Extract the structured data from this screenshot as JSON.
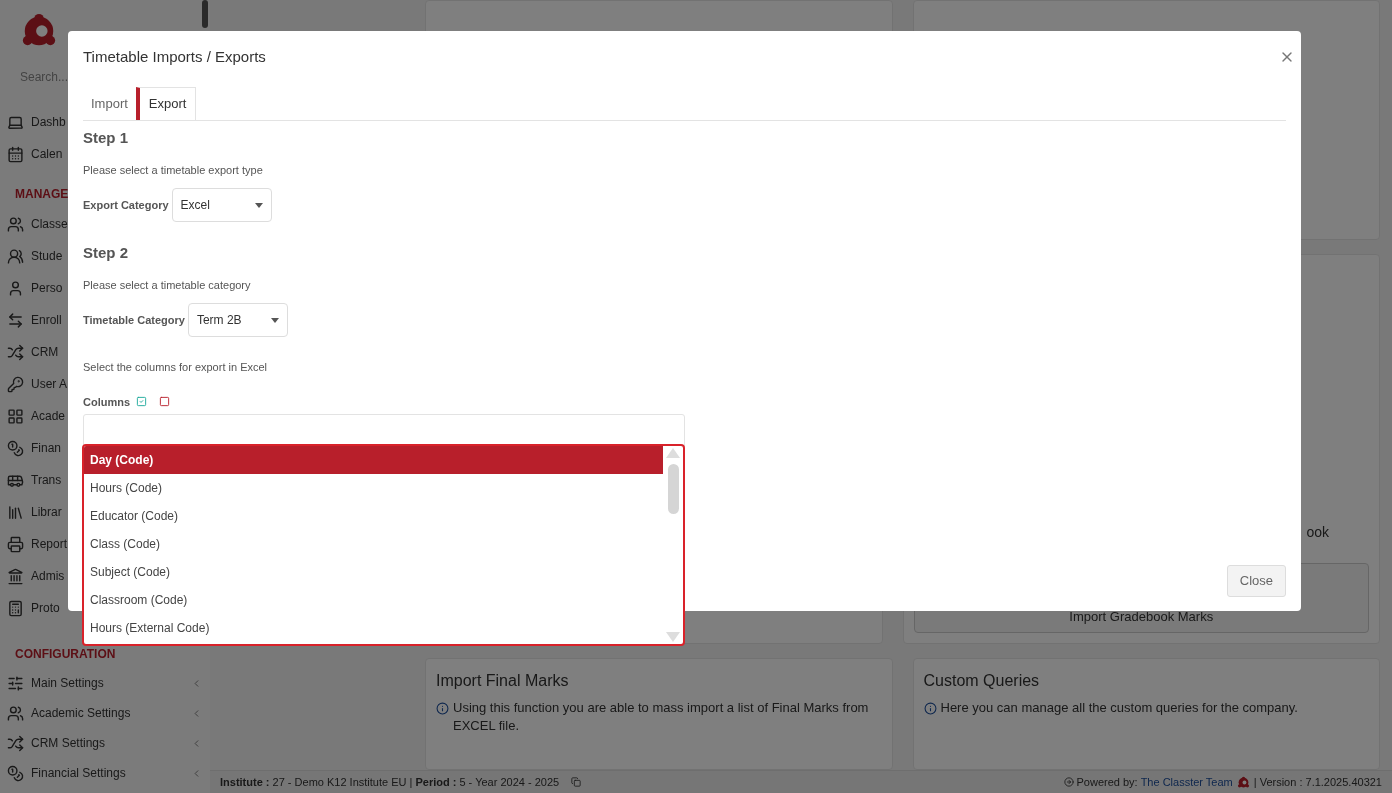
{
  "sidebar": {
    "search_placeholder": "Search...",
    "top_items": [
      {
        "label": "Dashb"
      },
      {
        "label": "Calen"
      }
    ],
    "sections": [
      {
        "title": "MANAGE",
        "items": [
          {
            "label": "Classe"
          },
          {
            "label": "Stude"
          },
          {
            "label": "Perso"
          },
          {
            "label": "Enroll"
          },
          {
            "label": "CRM"
          },
          {
            "label": "User A"
          },
          {
            "label": "Acade"
          },
          {
            "label": "Finan"
          },
          {
            "label": "Trans"
          },
          {
            "label": "Librar"
          },
          {
            "label": "Report"
          },
          {
            "label": "Admis"
          },
          {
            "label": "Proto"
          }
        ]
      },
      {
        "title": "CONFIGURATION",
        "items": [
          {
            "label": "Main Settings",
            "submenu": true
          },
          {
            "label": "Academic Settings",
            "submenu": true
          },
          {
            "label": "CRM Settings",
            "submenu": true
          },
          {
            "label": "Financial Settings",
            "submenu": true
          }
        ]
      }
    ]
  },
  "background": {
    "fragment": "ook",
    "gradebook_button": "Import Gradebook Marks",
    "cards": [
      {
        "title": "Import Final Marks",
        "info": "Using this function you are able to mass import a list of Final Marks from EXCEL file."
      },
      {
        "title": "Custom Queries",
        "info": "Here you can manage all the custom queries for the company."
      }
    ]
  },
  "status_bar": {
    "context": "**Institute :** 27 - Demo K12 Institute EU | **Period :** 5 - Year 2024 - 2025",
    "powered_by": "Powered by:",
    "team_link": "The Classter Team",
    "version": "| Version : 7.1.2025.40321"
  },
  "dialog": {
    "title": "Timetable Imports / Exports",
    "tabs": [
      {
        "label": "Import",
        "selected": false
      },
      {
        "label": "Export",
        "selected": true
      }
    ],
    "step1": {
      "heading": "Step 1",
      "hint": "Please select a timetable export type",
      "label": "Export Category",
      "value": "Excel"
    },
    "step2": {
      "heading": "Step 2",
      "hint": "Please select a timetable category",
      "label": "Timetable Category",
      "value": "Term 2B"
    },
    "columns_hint": "Select the columns for export in Excel",
    "columns_label": "Columns",
    "options": [
      {
        "label": "Day (Code)",
        "selected": true
      },
      {
        "label": "Hours (Code)",
        "selected": false
      },
      {
        "label": "Educator (Code)",
        "selected": false
      },
      {
        "label": "Class (Code)",
        "selected": false
      },
      {
        "label": "Subject (Code)",
        "selected": false
      },
      {
        "label": "Classroom (Code)",
        "selected": false
      },
      {
        "label": "Hours (External Code)",
        "selected": false
      }
    ],
    "close_button": "Close"
  }
}
